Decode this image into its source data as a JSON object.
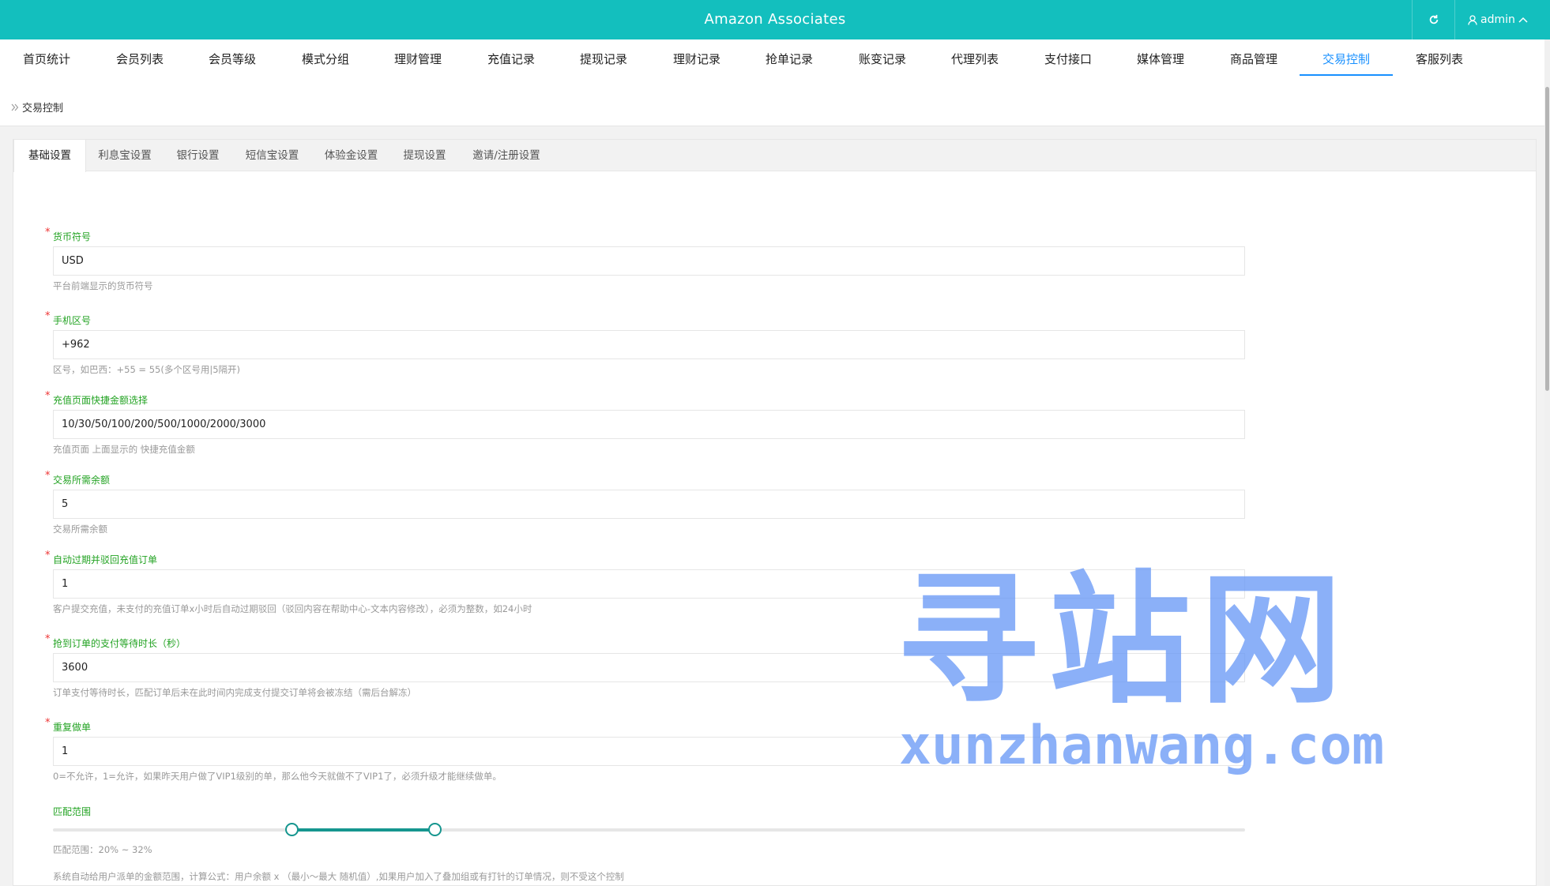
{
  "header": {
    "title": "Amazon Associates",
    "user": "admin",
    "accent": "#13bfbe"
  },
  "nav": {
    "items": [
      "首页统计",
      "会员列表",
      "会员等级",
      "模式分组",
      "理财管理",
      "充值记录",
      "提现记录",
      "理财记录",
      "抢单记录",
      "账变记录",
      "代理列表",
      "支付接口",
      "媒体管理",
      "商品管理",
      "交易控制",
      "客服列表"
    ],
    "active": "交易控制"
  },
  "breadcrumb": {
    "current": "交易控制"
  },
  "tabs": {
    "items": [
      "基础设置",
      "利息宝设置",
      "银行设置",
      "短信宝设置",
      "体验金设置",
      "提现设置",
      "邀请/注册设置"
    ],
    "active": "基础设置"
  },
  "form": {
    "currency": {
      "label": "货币符号",
      "value": "USD",
      "help": "平台前端显示的货币符号"
    },
    "phone_code": {
      "label": "手机区号",
      "value": "+962",
      "help": "区号，如巴西：+55 = 55(多个区号用|5隔开)"
    },
    "recharge_quick": {
      "label": "充值页面快捷金额选择",
      "value": "10/30/50/100/200/500/1000/2000/3000",
      "help": "充值页面 上面显示的 快捷充值金额"
    },
    "min_balance": {
      "label": "交易所需余额",
      "value": "5",
      "help": "交易所需余额"
    },
    "auto_expire": {
      "label": "自动过期并驳回充值订单",
      "value": "1",
      "help": "客户提交充值，未支付的充值订单x小时后自动过期驳回（驳回内容在帮助中心-文本内容修改），必须为整数，如24小时"
    },
    "pay_wait": {
      "label": "抢到订单的支付等待时长（秒）",
      "value": "3600",
      "help": "订单支付等待时长，匹配订单后未在此时间内完成支付提交订单将会被冻结（需后台解冻）"
    },
    "repeat_order": {
      "label": "重复做单",
      "value": "1",
      "help": "0=不允许，1=允许，如果昨天用户做了VIP1级别的单，那么他今天就做不了VIP1了，必须升级才能继续做单。"
    },
    "match_range": {
      "label": "匹配范围",
      "min": 20,
      "max": 32,
      "range_text": "匹配范围：20% ~ 32%",
      "help": "系统自动给用户派单的金额范围，计算公式：用户余额 x （最小～最大 随机值）,如果用户加入了叠加组或有打针的订单情况，则不受这个控制"
    }
  },
  "watermark": {
    "cn": "寻站网",
    "en": "xunzhanwang.com"
  }
}
